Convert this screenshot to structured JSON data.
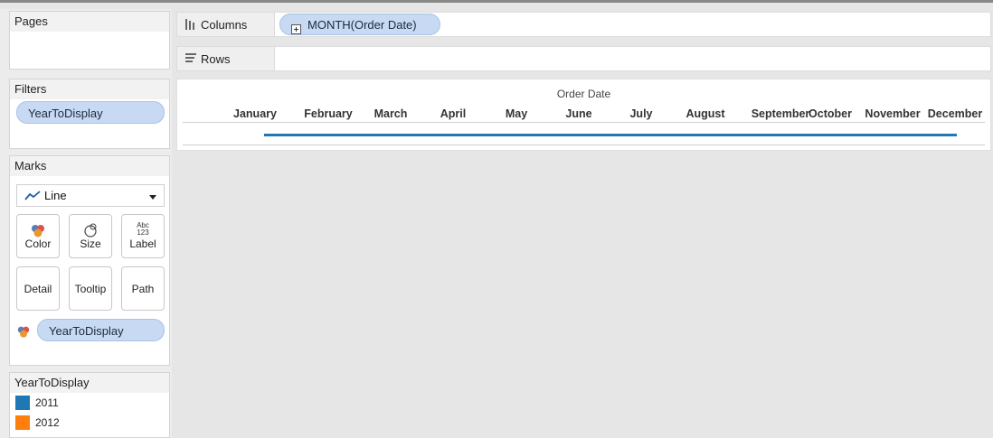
{
  "pages": {
    "title": "Pages"
  },
  "filters": {
    "title": "Filters",
    "pill": "YearToDisplay"
  },
  "marks": {
    "title": "Marks",
    "mark_type": "Line",
    "buttons": {
      "color": "Color",
      "size": "Size",
      "label": "Label",
      "detail": "Detail",
      "tooltip": "Tooltip",
      "path": "Path"
    },
    "label_glyph_top": "Abc",
    "label_glyph_bottom": "123",
    "color_pill": "YearToDisplay"
  },
  "legend": {
    "title": "YearToDisplay",
    "items": [
      {
        "label": "2011",
        "color": "#1f77b4"
      },
      {
        "label": "2012",
        "color": "#ff7f0e"
      }
    ]
  },
  "columns_shelf": {
    "label": "Columns",
    "pill": "MONTH(Order Date)"
  },
  "rows_shelf": {
    "label": "Rows"
  },
  "view": {
    "header_title": "Order Date",
    "months": [
      "January",
      "February",
      "March",
      "April",
      "May",
      "June",
      "July",
      "August",
      "September",
      "October",
      "November",
      "December"
    ],
    "line_color": "#1f77b4"
  }
}
